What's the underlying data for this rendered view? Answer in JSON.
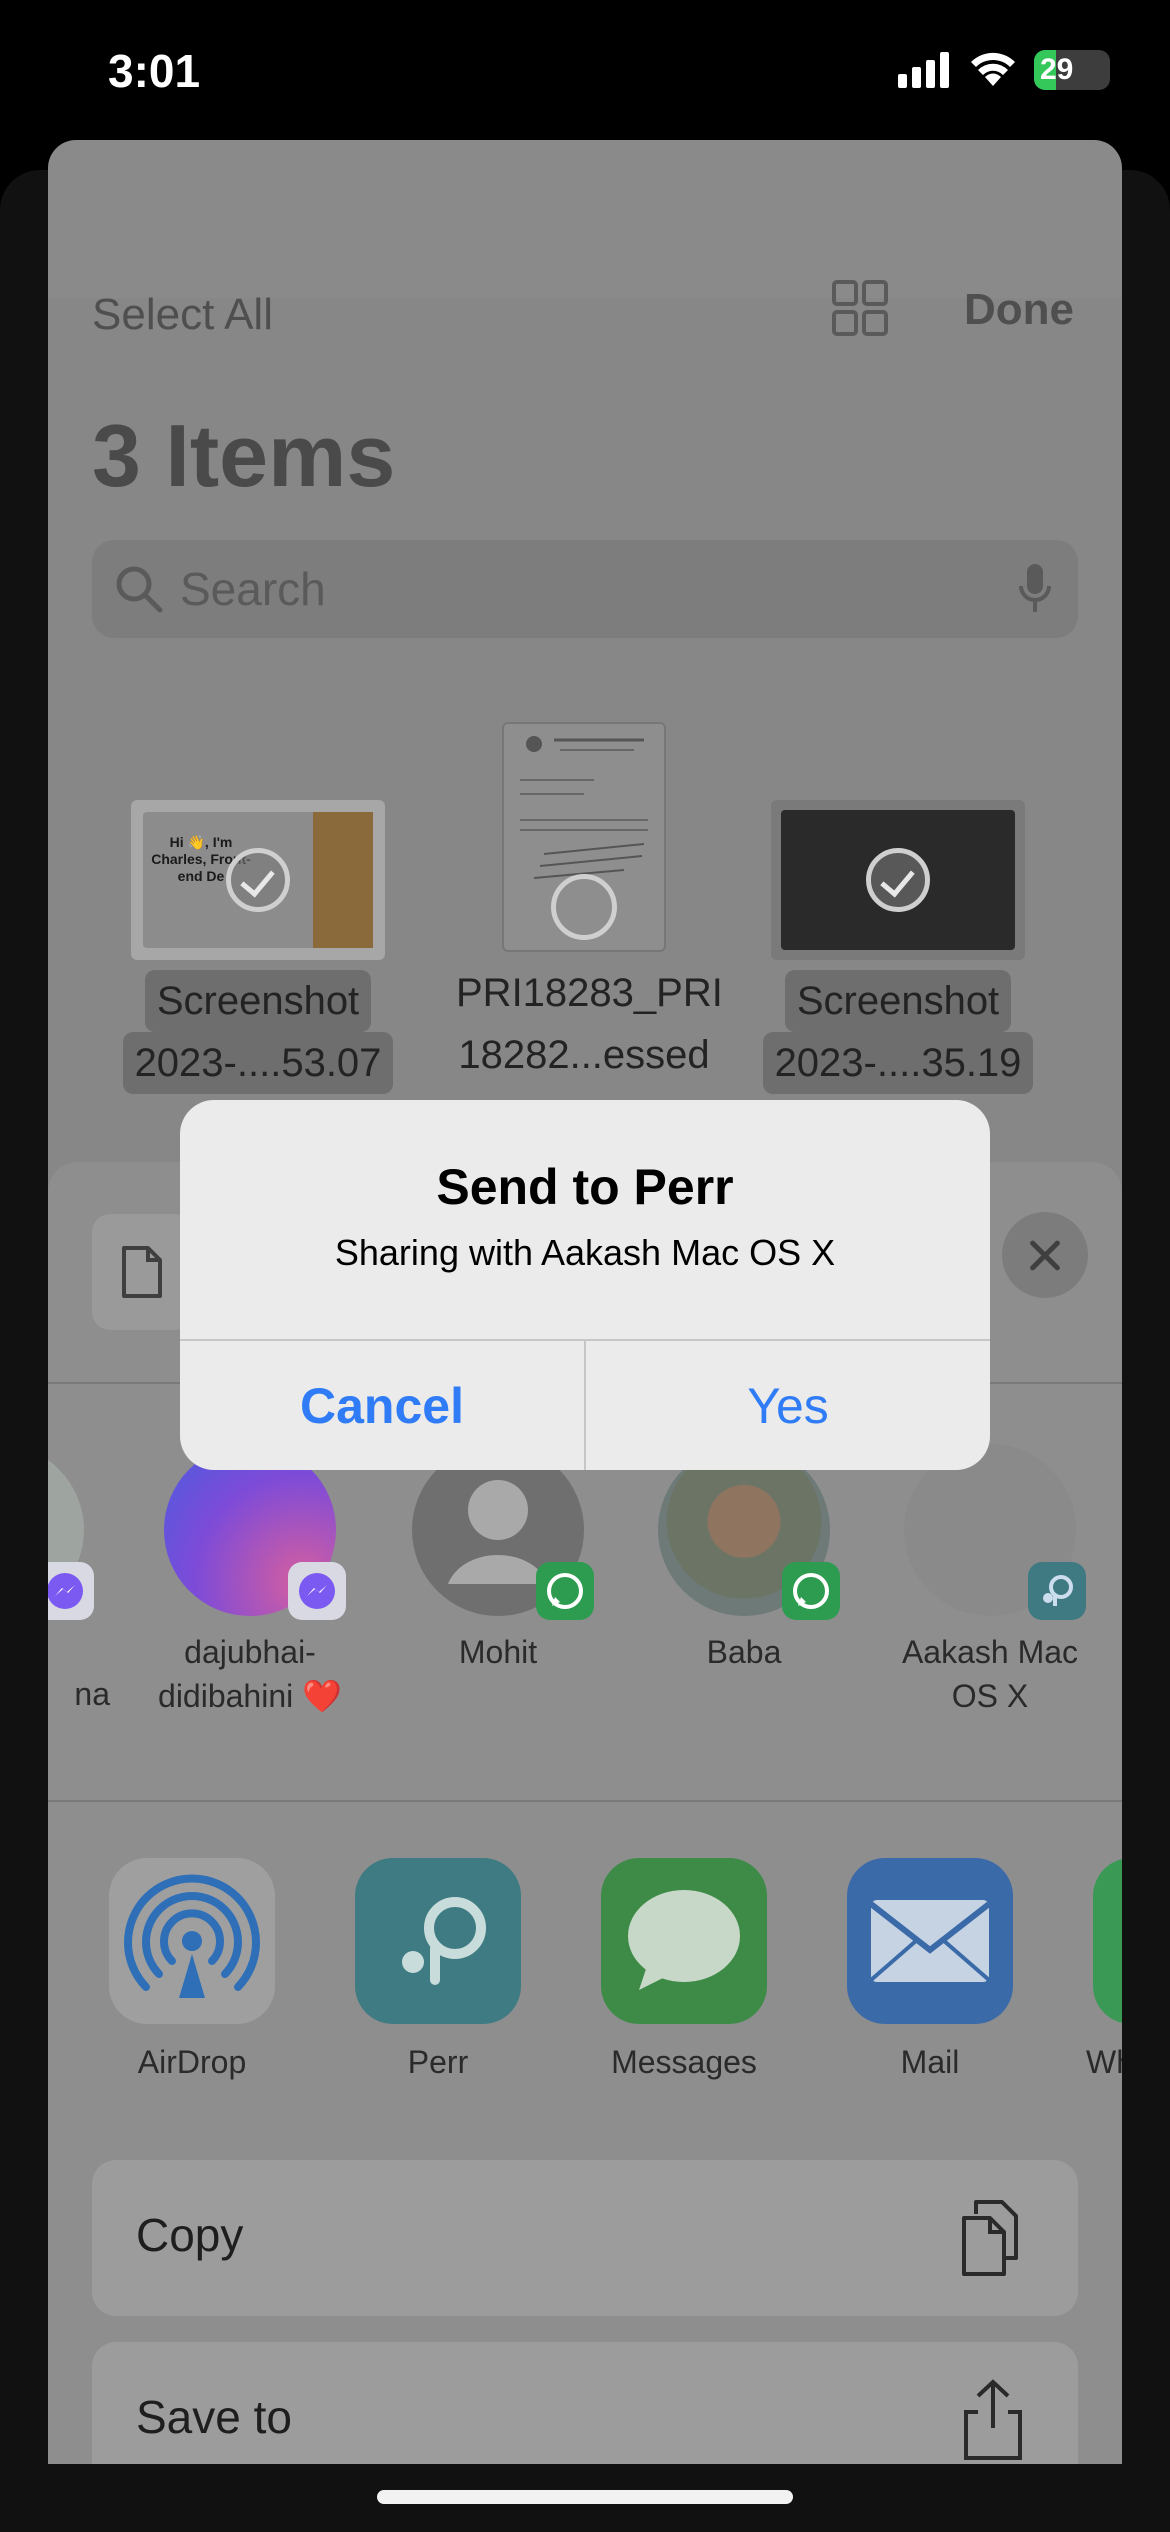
{
  "status_bar": {
    "time": "3:01",
    "battery": "29",
    "battery_fraction": 0.29
  },
  "files": {
    "select_all": "Select All",
    "done": "Done",
    "title": "3 Items",
    "search_placeholder": "Search",
    "items": [
      {
        "name_line1": "Screenshot",
        "name_line2": "2023-....53.07",
        "selected": true
      },
      {
        "name_line1": "PRI18283_PRI",
        "name_line2": "18282...essed",
        "selected": false
      },
      {
        "name_line1": "Screenshot",
        "name_line2": "2023-....35.19",
        "selected": true
      }
    ],
    "thumb1_text": "Hi 👋, I'm Charles, Front-end De"
  },
  "share": {
    "people": [
      {
        "name": "na",
        "badge": "messenger-icon"
      },
      {
        "name": "dajubhai-didibahini ❤️",
        "name_line1": "dajubhai-",
        "name_line2": "didibahini ❤️",
        "badge": "messenger-icon"
      },
      {
        "name": "Mohit",
        "badge": "whatsapp-icon"
      },
      {
        "name": "Baba",
        "badge": "whatsapp-icon"
      },
      {
        "name_line1": "Aakash Mac",
        "name_line2": "OS X",
        "badge": "perr-icon"
      }
    ],
    "apps": [
      {
        "name": "AirDrop",
        "icon": "airdrop-icon"
      },
      {
        "name": "Perr",
        "icon": "perr-icon"
      },
      {
        "name": "Messages",
        "icon": "messages-icon"
      },
      {
        "name": "Mail",
        "icon": "mail-icon"
      },
      {
        "name": "Wh",
        "icon": "whatsapp-icon"
      }
    ],
    "actions": [
      {
        "label": "Copy",
        "icon": "copy-icon"
      },
      {
        "label": "Save to",
        "icon": "share-icon"
      }
    ]
  },
  "alert": {
    "title": "Send to Perr",
    "message": "Sharing with Aakash Mac OS X",
    "cancel": "Cancel",
    "confirm": "Yes"
  },
  "colors": {
    "accent": "#2f7cf6",
    "whatsapp": "#25d366",
    "battery": "#34c759"
  }
}
